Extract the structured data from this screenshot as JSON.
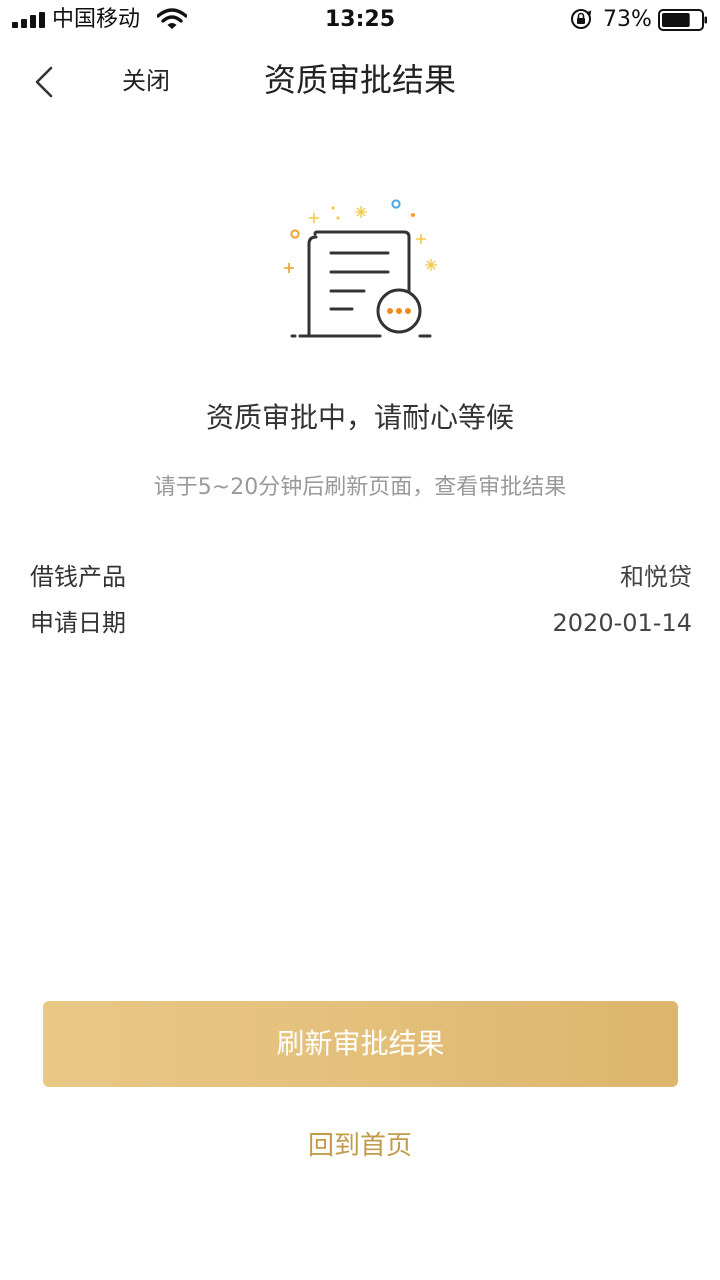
{
  "status_bar": {
    "carrier": "中国移动",
    "time": "13:25",
    "battery": "73%",
    "battery_level": 0.73,
    "icons": [
      "signal-icon",
      "wifi-icon",
      "rotation-lock-icon",
      "battery-icon"
    ]
  },
  "nav": {
    "back_icon": "chevron-left-icon",
    "close_label": "关闭",
    "title": "资质审批结果"
  },
  "illustration": {
    "icon": "document-pending-icon",
    "colors": {
      "stroke": "#333333",
      "accent": "#f08a1c",
      "sparkle_yellow": "#f2c94c",
      "sparkle_blue": "#4aa8e0"
    }
  },
  "result": {
    "title": "资质审批中，请耐心等候",
    "subtitle": "请于5~20分钟后刷新页面，查看审批结果"
  },
  "details": [
    {
      "label": "借钱产品",
      "value": "和悦贷"
    },
    {
      "label": "申请日期",
      "value": "2020-01-14"
    }
  ],
  "actions": {
    "refresh_label": "刷新审批结果",
    "home_label": "回到首页"
  },
  "colors": {
    "button_gradient_start": "#e9c885",
    "button_gradient_end": "#ddb56c",
    "link": "#c39a4c"
  }
}
